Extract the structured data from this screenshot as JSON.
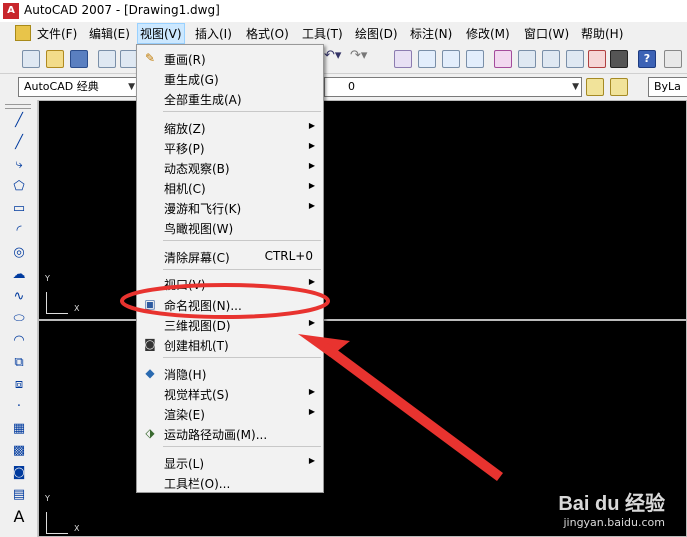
{
  "window": {
    "title": "AutoCAD 2007 - [Drawing1.dwg]"
  },
  "menubar": {
    "items": [
      "文件(F)",
      "编辑(E)",
      "视图(V)",
      "插入(I)",
      "格式(O)",
      "工具(T)",
      "绘图(D)",
      "标注(N)",
      "修改(M)",
      "窗口(W)",
      "帮助(H)"
    ],
    "active": "视图(V)"
  },
  "toolbar2": {
    "workspace": "AutoCAD 经典",
    "layer_value": "0",
    "linetype": "ByLa"
  },
  "viewport": {
    "y_label": "Y",
    "x_label": "X"
  },
  "view_menu": {
    "redraw": "重画(R)",
    "regen": "重生成(G)",
    "regen_all": "全部重生成(A)",
    "zoom": "缩放(Z)",
    "pan": "平移(P)",
    "orbit": "动态观察(B)",
    "camera": "相机(C)",
    "walk_fly": "漫游和飞行(K)",
    "aerial": "鸟瞰视图(W)",
    "clean_screen": "清除屏幕(C)",
    "clean_screen_shortcut": "CTRL+0",
    "viewports": "视口(V)",
    "named_views": "命名视图(N)...",
    "views_3d": "三维视图(D)",
    "create_camera": "创建相机(T)",
    "hide": "消隐(H)",
    "visual_styles": "视觉样式(S)",
    "render": "渲染(E)",
    "motion_path": "运动路径动画(M)...",
    "display": "显示(L)",
    "toolbars": "工具栏(O)..."
  },
  "annotation": {
    "color": "#e8332f"
  },
  "watermark": {
    "brand": "Bai du 经验",
    "url": "jingyan.baidu.com"
  }
}
